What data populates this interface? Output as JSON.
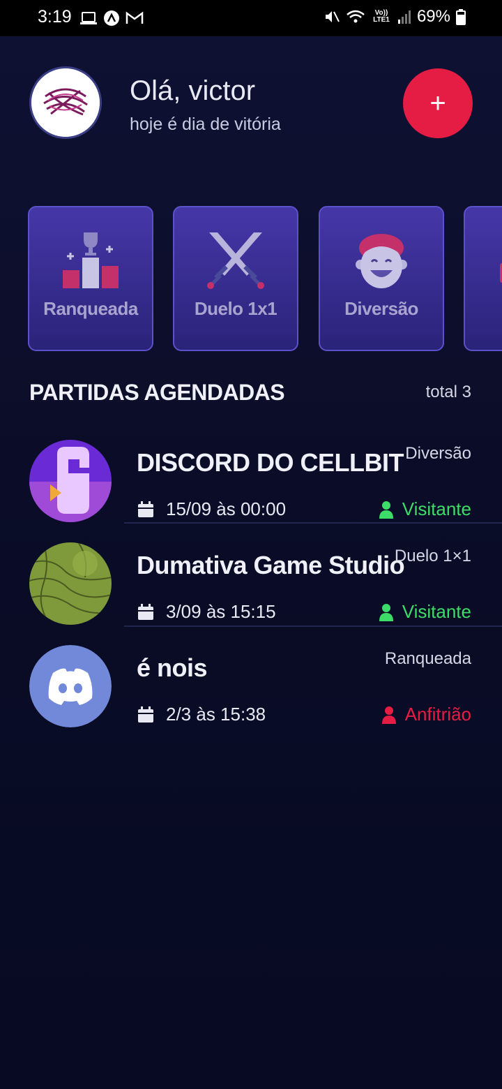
{
  "status_bar": {
    "time": "3:19",
    "battery": "69%",
    "network_label": "Vo)) LTE1"
  },
  "header": {
    "greeting": "Olá, victor",
    "subtitle": "hoje é dia de vitória",
    "add_label": "+"
  },
  "categories": [
    {
      "label": "Ranqueada",
      "icon": "podium-trophy-icon"
    },
    {
      "label": "Duelo 1x1",
      "icon": "crossed-swords-icon"
    },
    {
      "label": "Diversão",
      "icon": "smiling-face-icon"
    }
  ],
  "section": {
    "title": "PARTIDAS AGENDADAS",
    "total": "total 3"
  },
  "matches": [
    {
      "title": "DISCORD DO CELLBIT",
      "category": "Diversão",
      "date": "15/09 às 00:00",
      "role": "Visitante",
      "role_color": "#3ddc68"
    },
    {
      "title": "Dumativa Game Studio",
      "category": "Duelo 1×1",
      "date": "3/09 às 15:15",
      "role": "Visitante",
      "role_color": "#3ddc68"
    },
    {
      "title": "é nois",
      "category": "Ranqueada",
      "date": "2/3 às 15:38",
      "role": "Anfitrião",
      "role_color": "#e51c44"
    }
  ],
  "colors": {
    "accent": "#e51c44",
    "background": "#0b0d26",
    "card": "#4637a8",
    "visitor": "#3ddc68",
    "host": "#e51c44",
    "discord": "#7289da"
  }
}
